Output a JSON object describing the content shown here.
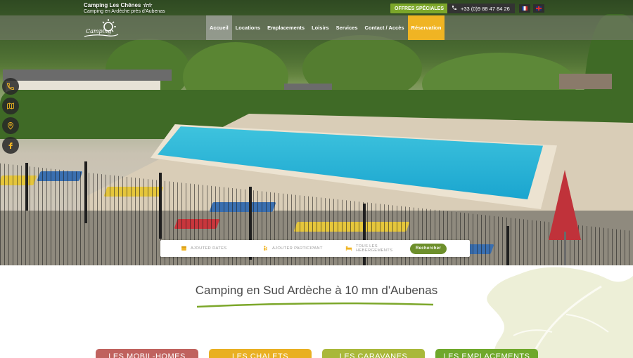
{
  "colors": {
    "accent_green": "#7ca72a",
    "reservation_yellow": "#f0b423",
    "pool_blue": "#1aa5cf"
  },
  "header": {
    "brand_name": "Camping Les Chênes",
    "brand_stars": "☆☆",
    "brand_subtitle": "Camping en Ardèche près d'Aubenas",
    "logo_text": "Camping",
    "offers_label": "OFFRES SPÉCIALES",
    "phone": "+33 (0)9 88 47 84 26",
    "languages": [
      {
        "code": "fr",
        "icon": "flag-france-icon"
      },
      {
        "code": "en",
        "icon": "flag-uk-icon"
      }
    ]
  },
  "nav": {
    "items": [
      {
        "label": "Accueil",
        "state": "active"
      },
      {
        "label": "Locations"
      },
      {
        "label": "Emplacements"
      },
      {
        "label": "Loisirs"
      },
      {
        "label": "Services"
      },
      {
        "label": "Contact / Accès"
      },
      {
        "label": "Réservation",
        "state": "highlight"
      }
    ]
  },
  "side_icons": [
    "phone-icon",
    "map-icon",
    "location-pin-icon",
    "facebook-icon"
  ],
  "search": {
    "dates_label": "Ajouter dates",
    "participants_label": "Ajouter participant",
    "types_label": "Tous les hebergements",
    "button_label": "Rechercher"
  },
  "main": {
    "title": "Camping en Sud Ardèche à 10 mn d'Aubenas",
    "categories": [
      {
        "label": "Les Mobil-homes",
        "color": "#c0625e"
      },
      {
        "label": "Les Chalets",
        "color": "#e9b022"
      },
      {
        "label": "Les Caravanes",
        "color": "#a9b83a"
      },
      {
        "label": "Les Emplacements",
        "color": "#6fa82b"
      }
    ]
  }
}
